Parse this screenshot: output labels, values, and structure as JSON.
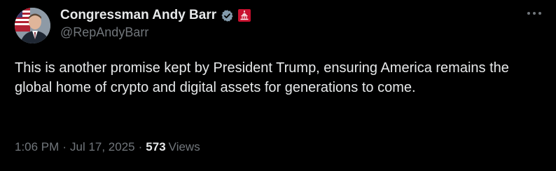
{
  "author": {
    "display_name": "Congressman Andy Barr",
    "handle": "@RepAndyBarr",
    "verified_badge": "verified-check-icon",
    "affiliation_badge": "us-capitol-icon",
    "avatar": "profile-photo-with-flag"
  },
  "tweet": {
    "text": "This is another promise kept by President Trump, ensuring America remains the global home of crypto and digital assets for generations to come."
  },
  "meta": {
    "time": "1:06 PM",
    "separator": "·",
    "date": "Jul 17, 2025",
    "views_count": "573",
    "views_label": "Views"
  },
  "menu": {
    "more_icon": "more-horizontal-icon"
  },
  "colors": {
    "background": "#000000",
    "primary_text": "#e7e9ea",
    "secondary_text": "#71767b",
    "verified_badge": "#829aab",
    "affiliation_badge": "#c8102e"
  }
}
